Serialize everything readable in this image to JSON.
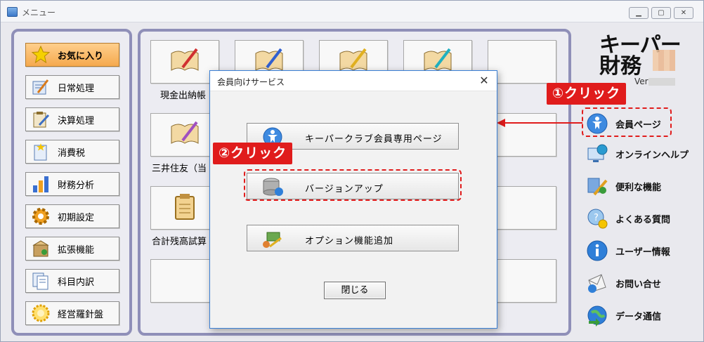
{
  "window": {
    "title": "メニュー"
  },
  "nav": [
    {
      "label": "お気に入り",
      "icon": "star-icon"
    },
    {
      "label": "日常処理",
      "icon": "ledger-pencil-icon"
    },
    {
      "label": "決算処理",
      "icon": "clipboard-pencil-icon"
    },
    {
      "label": "消費税",
      "icon": "document-star-icon"
    },
    {
      "label": "財務分析",
      "icon": "bar-chart-icon"
    },
    {
      "label": "初期設定",
      "icon": "gear-icon"
    },
    {
      "label": "拡張機能",
      "icon": "package-icon"
    },
    {
      "label": "科目内訳",
      "icon": "documents-icon"
    },
    {
      "label": "経営羅針盤",
      "icon": "compass-icon"
    }
  ],
  "tiles": [
    {
      "label": "現金出納帳"
    },
    {
      "label": "三井住友（当"
    },
    {
      "label": "合計残高試算"
    }
  ],
  "logo": {
    "line1": "キーパー",
    "line2": "財務",
    "version_prefix": "Ver"
  },
  "side_menu": [
    {
      "label": "会員ページ",
      "icon": "person-globe-icon"
    },
    {
      "label": "オンラインヘルプ",
      "icon": "monitor-globe-icon"
    },
    {
      "label": "便利な機能",
      "icon": "tools-icon"
    },
    {
      "label": "よくある質問",
      "icon": "faq-icon"
    },
    {
      "label": "ユーザー情報",
      "icon": "info-icon"
    },
    {
      "label": "お問い合せ",
      "icon": "mail-icon"
    },
    {
      "label": "データ通信",
      "icon": "globe-arrow-icon"
    }
  ],
  "dialog": {
    "title": "会員向けサービス",
    "close_symbol": "✕",
    "buttons": [
      {
        "label": "キーパークラブ会員専用ページ",
        "icon": "person-globe-icon"
      },
      {
        "label": "バージョンアップ",
        "icon": "database-icon"
      },
      {
        "label": "オプション機能追加",
        "icon": "gift-tools-icon"
      }
    ],
    "close_label": "閉じる"
  },
  "annotations": {
    "step1": "①クリック",
    "step2": "②クリック"
  },
  "colors": {
    "accent_red": "#e01c1c",
    "panel_border": "#8f8fb8",
    "dialog_border": "#3a7fd5"
  }
}
